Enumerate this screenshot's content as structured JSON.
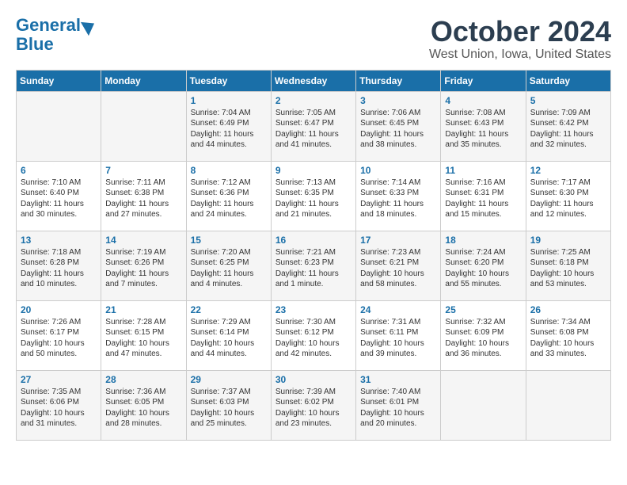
{
  "header": {
    "logo_line1": "General",
    "logo_line2": "Blue",
    "month": "October 2024",
    "location": "West Union, Iowa, United States"
  },
  "weekdays": [
    "Sunday",
    "Monday",
    "Tuesday",
    "Wednesday",
    "Thursday",
    "Friday",
    "Saturday"
  ],
  "weeks": [
    [
      {
        "day": "",
        "content": ""
      },
      {
        "day": "",
        "content": ""
      },
      {
        "day": "1",
        "content": "Sunrise: 7:04 AM\nSunset: 6:49 PM\nDaylight: 11 hours and 44 minutes."
      },
      {
        "day": "2",
        "content": "Sunrise: 7:05 AM\nSunset: 6:47 PM\nDaylight: 11 hours and 41 minutes."
      },
      {
        "day": "3",
        "content": "Sunrise: 7:06 AM\nSunset: 6:45 PM\nDaylight: 11 hours and 38 minutes."
      },
      {
        "day": "4",
        "content": "Sunrise: 7:08 AM\nSunset: 6:43 PM\nDaylight: 11 hours and 35 minutes."
      },
      {
        "day": "5",
        "content": "Sunrise: 7:09 AM\nSunset: 6:42 PM\nDaylight: 11 hours and 32 minutes."
      }
    ],
    [
      {
        "day": "6",
        "content": "Sunrise: 7:10 AM\nSunset: 6:40 PM\nDaylight: 11 hours and 30 minutes."
      },
      {
        "day": "7",
        "content": "Sunrise: 7:11 AM\nSunset: 6:38 PM\nDaylight: 11 hours and 27 minutes."
      },
      {
        "day": "8",
        "content": "Sunrise: 7:12 AM\nSunset: 6:36 PM\nDaylight: 11 hours and 24 minutes."
      },
      {
        "day": "9",
        "content": "Sunrise: 7:13 AM\nSunset: 6:35 PM\nDaylight: 11 hours and 21 minutes."
      },
      {
        "day": "10",
        "content": "Sunrise: 7:14 AM\nSunset: 6:33 PM\nDaylight: 11 hours and 18 minutes."
      },
      {
        "day": "11",
        "content": "Sunrise: 7:16 AM\nSunset: 6:31 PM\nDaylight: 11 hours and 15 minutes."
      },
      {
        "day": "12",
        "content": "Sunrise: 7:17 AM\nSunset: 6:30 PM\nDaylight: 11 hours and 12 minutes."
      }
    ],
    [
      {
        "day": "13",
        "content": "Sunrise: 7:18 AM\nSunset: 6:28 PM\nDaylight: 11 hours and 10 minutes."
      },
      {
        "day": "14",
        "content": "Sunrise: 7:19 AM\nSunset: 6:26 PM\nDaylight: 11 hours and 7 minutes."
      },
      {
        "day": "15",
        "content": "Sunrise: 7:20 AM\nSunset: 6:25 PM\nDaylight: 11 hours and 4 minutes."
      },
      {
        "day": "16",
        "content": "Sunrise: 7:21 AM\nSunset: 6:23 PM\nDaylight: 11 hours and 1 minute."
      },
      {
        "day": "17",
        "content": "Sunrise: 7:23 AM\nSunset: 6:21 PM\nDaylight: 10 hours and 58 minutes."
      },
      {
        "day": "18",
        "content": "Sunrise: 7:24 AM\nSunset: 6:20 PM\nDaylight: 10 hours and 55 minutes."
      },
      {
        "day": "19",
        "content": "Sunrise: 7:25 AM\nSunset: 6:18 PM\nDaylight: 10 hours and 53 minutes."
      }
    ],
    [
      {
        "day": "20",
        "content": "Sunrise: 7:26 AM\nSunset: 6:17 PM\nDaylight: 10 hours and 50 minutes."
      },
      {
        "day": "21",
        "content": "Sunrise: 7:28 AM\nSunset: 6:15 PM\nDaylight: 10 hours and 47 minutes."
      },
      {
        "day": "22",
        "content": "Sunrise: 7:29 AM\nSunset: 6:14 PM\nDaylight: 10 hours and 44 minutes."
      },
      {
        "day": "23",
        "content": "Sunrise: 7:30 AM\nSunset: 6:12 PM\nDaylight: 10 hours and 42 minutes."
      },
      {
        "day": "24",
        "content": "Sunrise: 7:31 AM\nSunset: 6:11 PM\nDaylight: 10 hours and 39 minutes."
      },
      {
        "day": "25",
        "content": "Sunrise: 7:32 AM\nSunset: 6:09 PM\nDaylight: 10 hours and 36 minutes."
      },
      {
        "day": "26",
        "content": "Sunrise: 7:34 AM\nSunset: 6:08 PM\nDaylight: 10 hours and 33 minutes."
      }
    ],
    [
      {
        "day": "27",
        "content": "Sunrise: 7:35 AM\nSunset: 6:06 PM\nDaylight: 10 hours and 31 minutes."
      },
      {
        "day": "28",
        "content": "Sunrise: 7:36 AM\nSunset: 6:05 PM\nDaylight: 10 hours and 28 minutes."
      },
      {
        "day": "29",
        "content": "Sunrise: 7:37 AM\nSunset: 6:03 PM\nDaylight: 10 hours and 25 minutes."
      },
      {
        "day": "30",
        "content": "Sunrise: 7:39 AM\nSunset: 6:02 PM\nDaylight: 10 hours and 23 minutes."
      },
      {
        "day": "31",
        "content": "Sunrise: 7:40 AM\nSunset: 6:01 PM\nDaylight: 10 hours and 20 minutes."
      },
      {
        "day": "",
        "content": ""
      },
      {
        "day": "",
        "content": ""
      }
    ]
  ]
}
